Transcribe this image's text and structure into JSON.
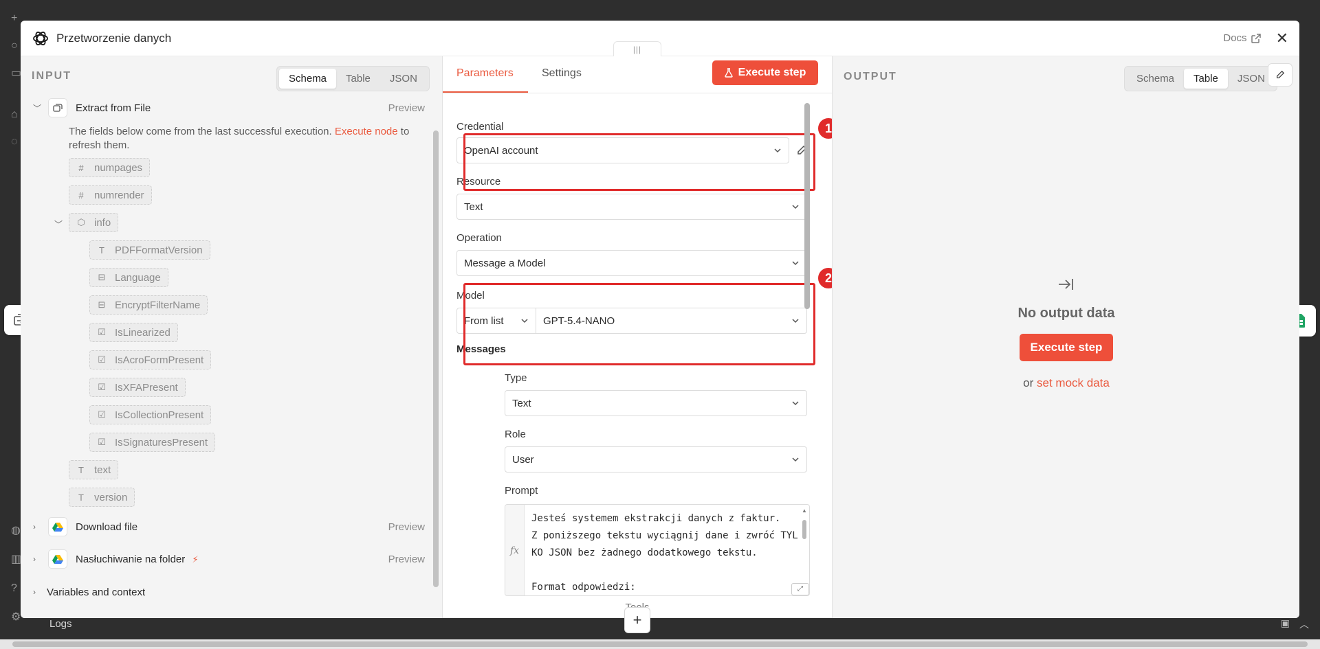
{
  "header": {
    "title": "Przetworzenie danych",
    "docs_label": "Docs",
    "drag_glyph": "|||"
  },
  "input": {
    "label": "INPUT",
    "view_tabs": [
      "Schema",
      "Table",
      "JSON"
    ],
    "active_tab": "Schema",
    "nodes": [
      {
        "name": "Extract from File",
        "preview": "Preview",
        "icon": "extract-file-icon"
      },
      {
        "name": "Download file",
        "preview": "Preview",
        "icon": "google-drive-icon"
      },
      {
        "name": "Nasłuchiwanie na folder",
        "preview": "Preview",
        "icon": "google-drive-icon",
        "trigger_icon": "lightning-icon"
      }
    ],
    "note_text": "The fields below come from the last successful execution.",
    "note_link": "Execute node",
    "note_suffix": "to refresh them.",
    "fields": [
      {
        "type": "#",
        "name": "numpages"
      },
      {
        "type": "#",
        "name": "numrender"
      },
      {
        "type": "obj",
        "name": "info"
      },
      {
        "type": "T",
        "name": "PDFFormatVersion"
      },
      {
        "type": "list",
        "name": "Language"
      },
      {
        "type": "list",
        "name": "EncryptFilterName"
      },
      {
        "type": "check",
        "name": "IsLinearized"
      },
      {
        "type": "check",
        "name": "IsAcroFormPresent"
      },
      {
        "type": "check",
        "name": "IsXFAPresent"
      },
      {
        "type": "check",
        "name": "IsCollectionPresent"
      },
      {
        "type": "check",
        "name": "IsSignaturesPresent"
      },
      {
        "type": "T",
        "name": "text"
      },
      {
        "type": "T",
        "name": "version"
      }
    ],
    "variables_label": "Variables and context"
  },
  "params": {
    "tabs": [
      "Parameters",
      "Settings"
    ],
    "active_tab": "Parameters",
    "execute_label": "Execute step",
    "credential_label": "Credential",
    "credential_value": "OpenAI account",
    "resource_label": "Resource",
    "resource_value": "Text",
    "operation_label": "Operation",
    "operation_value": "Message a Model",
    "model_label": "Model",
    "model_mode": "From list",
    "model_value": "GPT-5.4-NANO",
    "messages_label": "Messages",
    "type_label": "Type",
    "type_value": "Text",
    "role_label": "Role",
    "role_value": "User",
    "prompt_label": "Prompt",
    "prompt_fx": "fx",
    "prompt_text": "Jesteś systemem ekstrakcji danych z faktur.\nZ poniższego tekstu wyciągnij dane i zwróć TYLKO JSON bez żadnego dodatkowego tekstu.\n\nFormat odpowiedzi:",
    "tools_label": "Tools",
    "annotations": [
      "1",
      "2"
    ]
  },
  "output": {
    "label": "OUTPUT",
    "view_tabs": [
      "Schema",
      "Table",
      "JSON"
    ],
    "active_tab": "Table",
    "empty_title": "No output data",
    "execute_label": "Execute step",
    "or_text": "or",
    "mock_link": "set mock data"
  },
  "background": {
    "logs_label": "Logs"
  },
  "colors": {
    "accent": "#ee4f3a",
    "highlight": "#e02b2b"
  }
}
